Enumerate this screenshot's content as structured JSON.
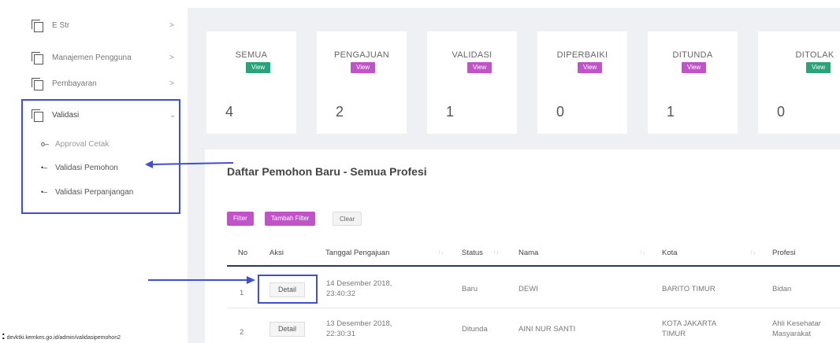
{
  "sidebar": {
    "items": [
      {
        "label": "E Str",
        "chevron": ">"
      },
      {
        "label": "Manajemen Pengguna",
        "chevron": ">"
      },
      {
        "label": "Pembayaran",
        "chevron": ">"
      },
      {
        "label": "Validasi",
        "chevron": "⌄"
      }
    ],
    "sub_items": [
      {
        "label": "Approval Cetak",
        "bullet": "o–"
      },
      {
        "label": "Validasi Pemohon",
        "bullet": "•–"
      },
      {
        "label": "Validasi Perpanjangan",
        "bullet": "•–"
      }
    ]
  },
  "stats": [
    {
      "title": "SEMUA",
      "button": "View",
      "value": "4",
      "color": "#2aa37a"
    },
    {
      "title": "PENGAJUAN",
      "button": "View",
      "value": "2",
      "color": "#c152ca"
    },
    {
      "title": "VALIDASI",
      "button": "View",
      "value": "1",
      "color": "#c152ca"
    },
    {
      "title": "DIPERBAIKI",
      "button": "View",
      "value": "0",
      "color": "#c152ca"
    },
    {
      "title": "DITUNDA",
      "button": "View",
      "value": "1",
      "color": "#c152ca"
    },
    {
      "title": "DITOLAK",
      "button": "View",
      "value": "0",
      "color": "#2aa37a"
    }
  ],
  "list": {
    "title": "Daftar Pemohon Baru - Semua Profesi",
    "buttons": {
      "filter": "Filter",
      "tambah_filter": "Tambah Filter",
      "clear": "Clear"
    },
    "columns": [
      "No",
      "Aksi",
      "Tanggal Pengajuan",
      "Status",
      "Nama",
      "Kota",
      "Profesi"
    ],
    "sort_icon": "↑↓",
    "rows": [
      {
        "no": "1",
        "aksi": "Detail",
        "tanggal": "14 Desember 2018,",
        "jam": "23:40:32",
        "status": "Baru",
        "nama": "DEWI",
        "kota": "BARITO TIMUR",
        "kota2": "",
        "profesi": "Bidan",
        "profesi2": ""
      },
      {
        "no": "2",
        "aksi": "Detail",
        "tanggal": "13 Desember 2018,",
        "jam": "22:30:31",
        "status": "Ditunda",
        "nama": "AINI NUR SANTI",
        "kota": "KOTA JAKARTA",
        "kota2": "TIMUR",
        "profesi": "Ahli Kesehatar",
        "profesi2": "Masyarakat"
      }
    ]
  },
  "colors": {
    "accent_purple": "#c152ca",
    "accent_green": "#2aa37a",
    "highlight_blue": "#3f4fd0"
  },
  "status_bar": {
    "url": "devktki.kemkes.go.id/admin/validasipemohon2",
    "marker": ":"
  }
}
